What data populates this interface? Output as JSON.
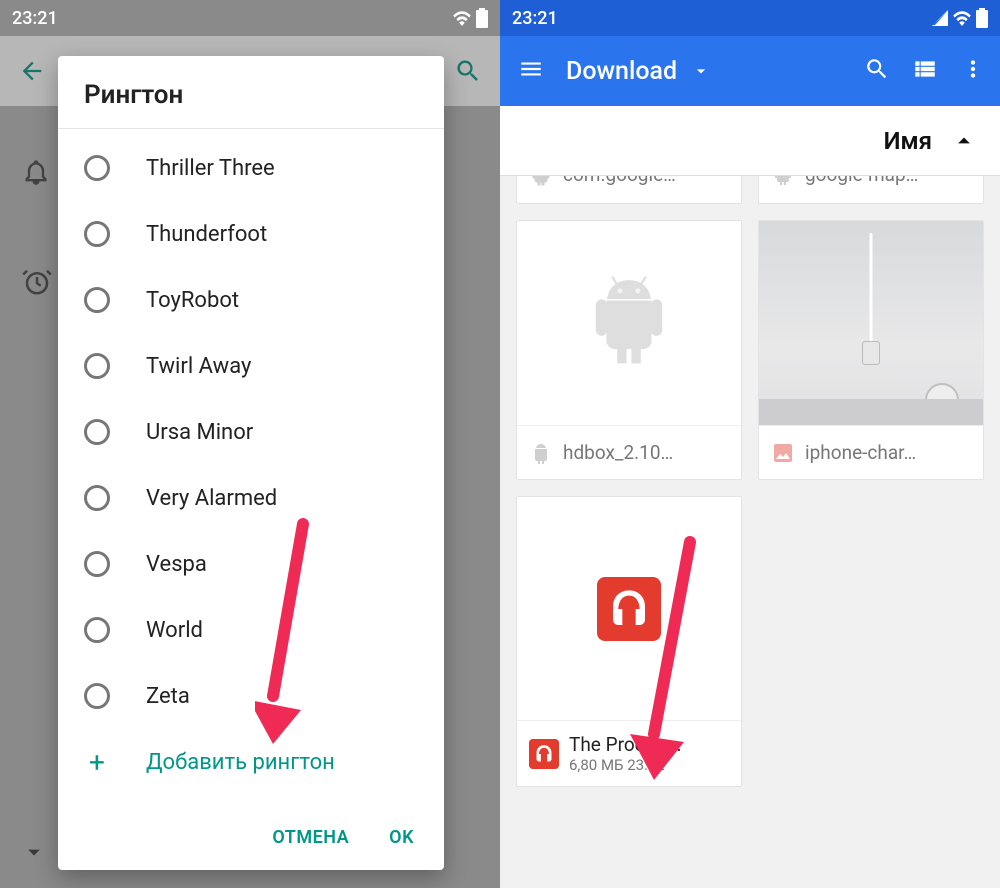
{
  "left": {
    "status_time": "23:21",
    "dialog_title": "Рингтон",
    "ringtones": [
      "Thriller Three",
      "Thunderfoot",
      "ToyRobot",
      "Twirl Away",
      "Ursa Minor",
      "Very Alarmed",
      "Vespa",
      "World",
      "Zeta"
    ],
    "add_label": "Добавить рингтон",
    "cancel": "ОТМЕНА",
    "ok": "OK"
  },
  "right": {
    "status_time": "23:21",
    "appbar_title": "Download",
    "sort_label": "Имя",
    "tiles": {
      "google_apk": "com.google…",
      "google_maps": "google-map…",
      "hdbox": "hdbox_2.10…",
      "iphone": "iphone-char…",
      "prodigy_name": "The Prodigy…",
      "prodigy_meta": "6,80 МБ 23:02"
    }
  },
  "colors": {
    "teal": "#009688",
    "blue": "#2a74ee",
    "arrow": "#ee2a55"
  }
}
